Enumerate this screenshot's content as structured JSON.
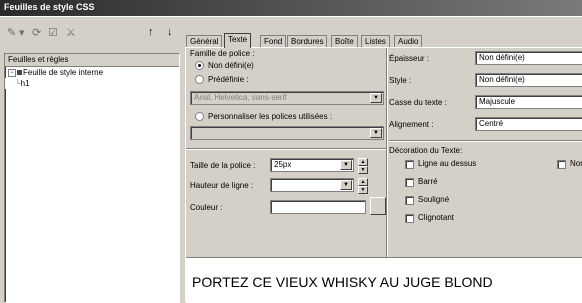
{
  "window": {
    "title": "Feuilles de style CSS"
  },
  "toolbar": {
    "icons": [
      "new-style-icon",
      "dropdown-arrow-icon",
      "undo-icon",
      "edit-icon",
      "delete-icon",
      "move-up-icon",
      "move-down-icon"
    ],
    "glyphs": {
      "new": "✎",
      "arrow": "▾",
      "undo": "⟳",
      "edit": "☑",
      "del": "⚔",
      "up": "↑",
      "down": "↓"
    }
  },
  "tree": {
    "header": "Feuilles et règles",
    "items": [
      "Feuille de style interne",
      "h1"
    ]
  },
  "tabs": [
    "Général",
    "Texte",
    "Fond",
    "Bordures",
    "Boîte",
    "Listes",
    "Audio"
  ],
  "active_tab": "Texte",
  "font_family": {
    "label": "Famille de police :",
    "opt_undefined": "Non défini(e)",
    "opt_predefined": "Prédéfinie :",
    "predefined_value": "Arial, Helvetica, sans-serif",
    "opt_custom": "Personnaliser les polices utilisées :",
    "custom_value": ""
  },
  "size": {
    "label": "Taille de la police :",
    "value": "25px"
  },
  "line_height": {
    "label": "Hauteur de ligne :",
    "value": ""
  },
  "color": {
    "label": "Couleur :",
    "value": ""
  },
  "right": {
    "thickness_label": "Épaisseur :",
    "thickness_value": "Non défini(e)",
    "style_label": "Style :",
    "style_value": "Non défini(e)",
    "case_label": "Casse du texte :",
    "case_value": "Majuscule",
    "align_label": "Alignement :",
    "align_value": "Centré"
  },
  "decoration": {
    "label": "Décoration du Texte:",
    "overline": "Ligne au dessus",
    "none": "Non",
    "strike": "Barré",
    "underline": "Souligné",
    "blink": "Clignotant"
  },
  "preview": {
    "text": "PORTEZ CE VIEUX WHISKY AU JUGE BLOND"
  }
}
